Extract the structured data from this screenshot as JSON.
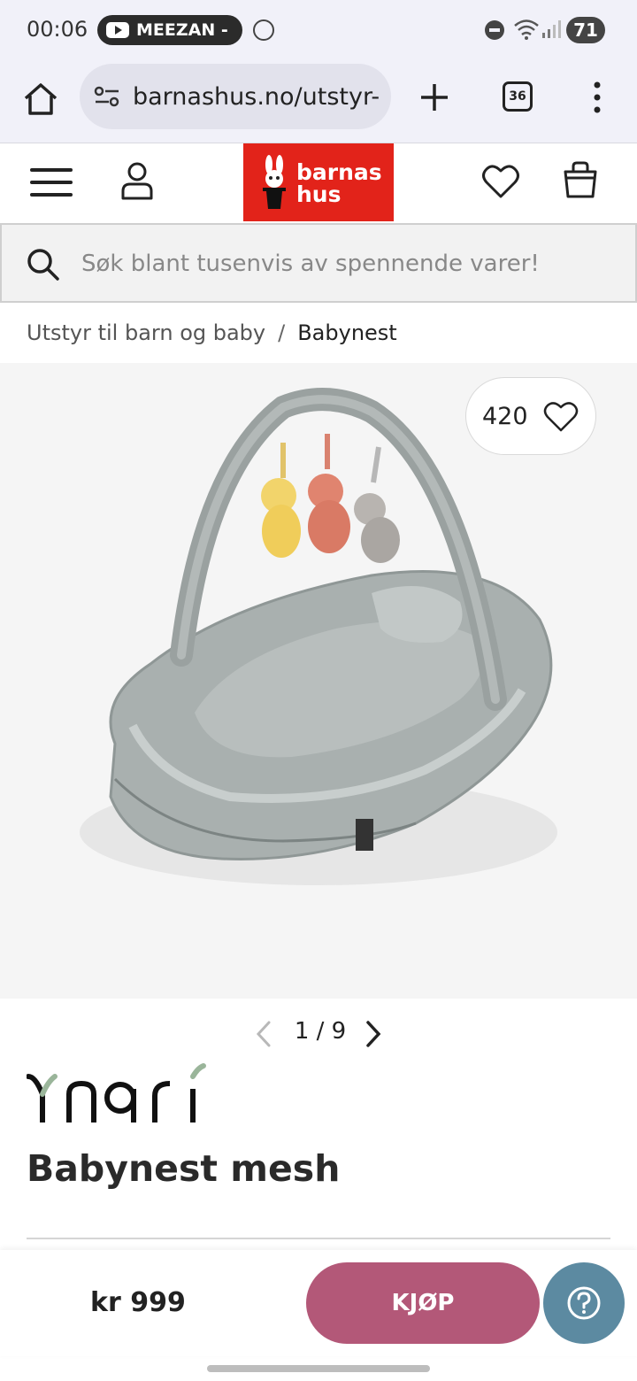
{
  "status_bar": {
    "time": "00:06",
    "notification_label": "MEEZAN -",
    "battery": "71",
    "icons": [
      "youtube-icon",
      "whatsapp-icon",
      "dnd-icon",
      "wifi-icon",
      "signal-icon",
      "battery-icon"
    ]
  },
  "browser": {
    "url": "barnashus.no/utstyr-",
    "tab_count": "36",
    "icons": [
      "home-icon",
      "site-settings-icon",
      "plus-icon",
      "tabs-icon",
      "more-icon"
    ]
  },
  "header": {
    "logo_line1": "barnas",
    "logo_line2": "hus",
    "logo_color": "#e2231a",
    "icons": [
      "hamburger-icon",
      "user-icon",
      "heart-icon",
      "bag-icon"
    ]
  },
  "search": {
    "placeholder": "Søk blant tusenvis av spennende varer!"
  },
  "breadcrumb": {
    "parent": "Utstyr til barn og baby",
    "separator": "/",
    "current": "Babynest"
  },
  "gallery": {
    "favorite_count": "420",
    "pager_text": "1 / 9",
    "current": 1,
    "total": 9
  },
  "product": {
    "brand": "Yngri",
    "title": "Babynest mesh",
    "price": "kr 999"
  },
  "actions": {
    "buy_label": "KJØP",
    "buy_color": "#b35878",
    "help_color": "#5c8aa1"
  }
}
